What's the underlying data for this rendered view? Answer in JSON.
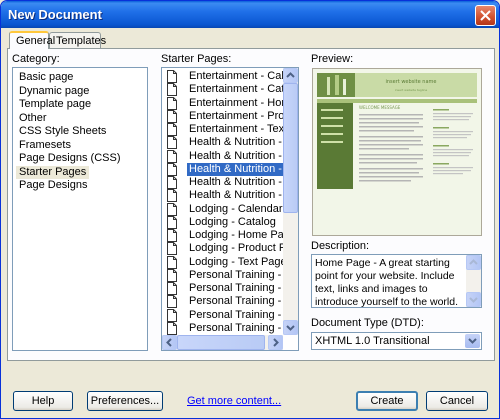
{
  "window": {
    "title": "New Document"
  },
  "tabs": [
    "General",
    "Templates"
  ],
  "category": {
    "label": "Category:",
    "items": [
      "Basic page",
      "Dynamic page",
      "Template page",
      "Other",
      "CSS Style Sheets",
      "Framesets",
      "Page Designs (CSS)",
      "Starter Pages",
      "Page Designs"
    ],
    "selected": "Starter Pages"
  },
  "starter_pages": {
    "label": "Starter Pages:",
    "items": [
      "Entertainment - Calend",
      "Entertainment - Catalo",
      "Entertainment - Home F",
      "Entertainment - Produc",
      "Entertainment - Text P",
      "Health & Nutrition - Cal",
      "Health & Nutrition - Cat",
      "Health & Nutrition - Ho",
      "Health & Nutrition - Pro",
      "Health & Nutrition - Tex",
      "Lodging - Calendar",
      "Lodging - Catalog",
      "Lodging - Home Page",
      "Lodging - Product Page",
      "Lodging - Text Page",
      "Personal Training - Cale",
      "Personal Training - Cata",
      "Personal Training - Hom",
      "Personal Training - Prod",
      "Personal Training - Tex"
    ],
    "selected": "Health & Nutrition - Ho"
  },
  "preview": {
    "label": "Preview:",
    "site_title": "insert website name",
    "site_tagline": "insert website tagline",
    "section_heading": "WELCOME MESSAGE"
  },
  "description": {
    "label": "Description:",
    "text": "Home Page - A great starting point for your website. Include text, links and images to introduce yourself to the world. Layout is customizable."
  },
  "doctype": {
    "label": "Document Type (DTD):",
    "value": "XHTML 1.0 Transitional"
  },
  "buttons": {
    "help": "Help",
    "preferences": "Preferences...",
    "get_more": "Get more content...",
    "create": "Create",
    "cancel": "Cancel"
  },
  "colors": {
    "title_bar": "#0a56d0",
    "selection": "#316ac5",
    "dialog_bg": "#ece9d8",
    "preview_green": "#5a7a35"
  }
}
